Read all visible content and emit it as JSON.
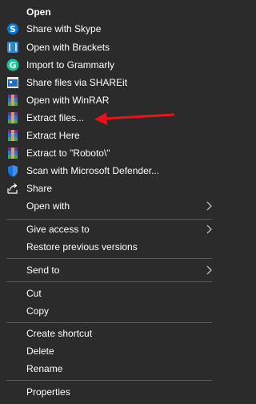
{
  "menu": {
    "items": [
      {
        "label": "Open",
        "icon": "none"
      },
      {
        "label": "Share with Skype",
        "icon": "skype-icon"
      },
      {
        "label": "Open with Brackets",
        "icon": "brackets-icon"
      },
      {
        "label": "Import to Grammarly",
        "icon": "grammarly-icon"
      },
      {
        "label": "Share files via SHAREit",
        "icon": "shareit-icon"
      },
      {
        "label": "Open with WinRAR",
        "icon": "winrar-icon"
      },
      {
        "label": "Extract files...",
        "icon": "winrar-icon"
      },
      {
        "label": "Extract Here",
        "icon": "winrar-icon"
      },
      {
        "label": "Extract to \"Roboto\\\"",
        "icon": "winrar-icon"
      },
      {
        "label": "Scan with Microsoft Defender...",
        "icon": "defender-shield-icon"
      },
      {
        "label": "Share",
        "icon": "share-icon"
      },
      {
        "label": "Open with",
        "icon": "none",
        "submenu": true
      },
      {
        "label": "Give access to",
        "icon": "none",
        "submenu": true
      },
      {
        "label": "Restore previous versions",
        "icon": "none"
      },
      {
        "label": "Send to",
        "icon": "none",
        "submenu": true
      },
      {
        "label": "Cut",
        "icon": "none"
      },
      {
        "label": "Copy",
        "icon": "none"
      },
      {
        "label": "Create shortcut",
        "icon": "none"
      },
      {
        "label": "Delete",
        "icon": "none"
      },
      {
        "label": "Rename",
        "icon": "none"
      },
      {
        "label": "Properties",
        "icon": "none"
      }
    ]
  },
  "colors": {
    "background": "#2b2b2b",
    "text": "#ffffff",
    "separator": "#5a5a5a",
    "annotation_arrow": "#e8141b"
  }
}
